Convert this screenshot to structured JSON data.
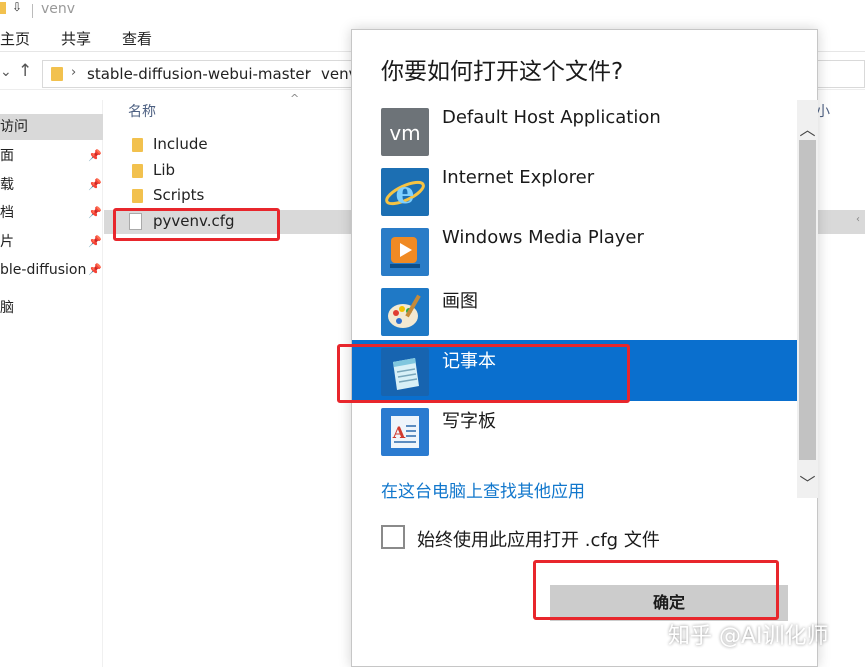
{
  "window": {
    "quick_access": "⇩",
    "title": "venv"
  },
  "ribbon": {
    "tabs": [
      "主页",
      "共享",
      "查看"
    ]
  },
  "address": {
    "segments": [
      "stable-diffusion-webui-master",
      "venv"
    ]
  },
  "sidebar": {
    "items": [
      {
        "label": "访问",
        "pinned": false,
        "active": true
      },
      {
        "label": "面",
        "pinned": true,
        "active": false
      },
      {
        "label": "载",
        "pinned": true,
        "active": false
      },
      {
        "label": "档",
        "pinned": true,
        "active": false
      },
      {
        "label": "片",
        "pinned": true,
        "active": false
      },
      {
        "label": "ble-diffusion",
        "pinned": true,
        "active": false
      },
      {
        "label": "脑",
        "pinned": false,
        "active": false
      }
    ]
  },
  "filelist": {
    "column_name": "名称",
    "column_right": "小",
    "files": [
      {
        "name": "Include",
        "type": "folder"
      },
      {
        "name": "Lib",
        "type": "folder"
      },
      {
        "name": "Scripts",
        "type": "folder"
      },
      {
        "name": "pyvenv.cfg",
        "type": "file",
        "selected": true
      }
    ]
  },
  "dialog": {
    "title": "你要如何打开这个文件?",
    "apps": [
      {
        "name": "Default Host Application",
        "icon": "vmware-icon",
        "icon_text": "vm"
      },
      {
        "name": "Internet Explorer",
        "icon": "internet-explorer-icon",
        "icon_text": "e"
      },
      {
        "name": "Windows Media Player",
        "icon": "windows-media-player-icon",
        "icon_text": ""
      },
      {
        "name": "画图",
        "icon": "paint-icon",
        "icon_text": ""
      },
      {
        "name": "记事本",
        "icon": "notepad-icon",
        "icon_text": "",
        "selected": true
      },
      {
        "name": "写字板",
        "icon": "wordpad-icon",
        "icon_text": "A"
      }
    ],
    "find_link": "在这台电脑上查找其他应用",
    "checkbox_label": "始终使用此应用打开 .cfg 文件",
    "checkbox_checked": false,
    "ok_label": "确定"
  },
  "watermark": "知乎 @AI训化师",
  "colors": {
    "accent": "#0a6fce",
    "link": "#1177cc",
    "annotation": "#e8262c",
    "folder": "#f2c14e"
  }
}
